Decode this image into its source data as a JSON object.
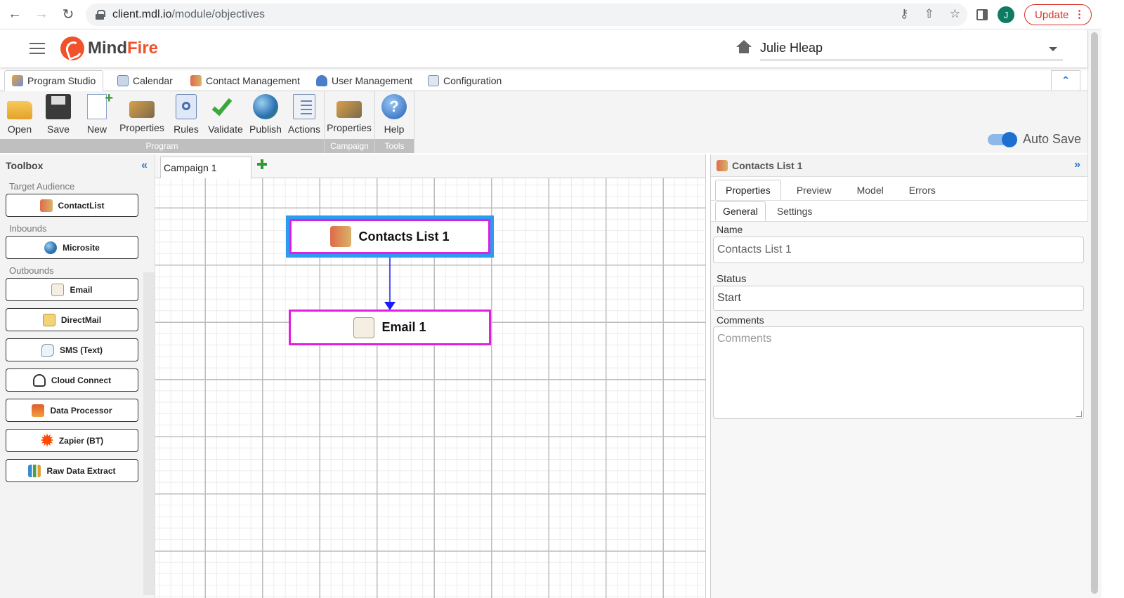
{
  "browser": {
    "url_host": "client.mdl.io",
    "url_path": "/module/objectives",
    "avatar_letter": "J",
    "update_label": "Update",
    "icons": [
      "back-icon",
      "forward-icon",
      "reload-icon",
      "lock-icon",
      "key-icon",
      "share-icon",
      "star-icon",
      "side-panel-icon",
      "more-icon"
    ]
  },
  "app": {
    "logo_mind": "Mind",
    "logo_fire": "Fire",
    "user_name": "Julie Hleap",
    "brand_color": "#f0522b"
  },
  "main_tabs": [
    {
      "label": "Program Studio",
      "icon": "program-studio-icon"
    },
    {
      "label": "Calendar",
      "icon": "calendar-icon"
    },
    {
      "label": "Contact Management",
      "icon": "contacts-icon"
    },
    {
      "label": "User Management",
      "icon": "user-icon"
    },
    {
      "label": "Configuration",
      "icon": "configuration-icon"
    }
  ],
  "ribbon": {
    "program": [
      "Open",
      "Save",
      "New",
      "Properties",
      "Rules",
      "Validate",
      "Publish",
      "Actions"
    ],
    "campaign": [
      "Properties"
    ],
    "tools": [
      "Help"
    ],
    "group_program": "Program",
    "group_campaign": "Campaign",
    "group_tools": "Tools",
    "autosave_label": "Auto Save",
    "autosave_on": true
  },
  "toolbox": {
    "title": "Toolbox",
    "sections": [
      {
        "label": "Target Audience",
        "items": [
          "ContactList"
        ]
      },
      {
        "label": "Inbounds",
        "items": [
          "Microsite"
        ]
      },
      {
        "label": "Outbounds",
        "items": [
          "Email",
          "DirectMail",
          "SMS (Text)",
          "Cloud Connect",
          "Data Processor",
          "Zapier (BT)",
          "Raw Data Extract"
        ]
      }
    ]
  },
  "canvas": {
    "tab_label": "Campaign 1",
    "nodes": [
      {
        "label": "Contacts List 1",
        "selected": true
      },
      {
        "label": "Email 1",
        "selected": false
      }
    ],
    "connector_color": "#1a1aff",
    "node_border_color": "#e020e0",
    "selection_color": "#2b9cf0"
  },
  "properties": {
    "title": "Contacts List 1",
    "tabs": [
      "Properties",
      "Preview",
      "Model",
      "Errors"
    ],
    "subtabs": [
      "General",
      "Settings"
    ],
    "name_label": "Name",
    "name_value": "Contacts List 1",
    "status_label": "Status",
    "status_value": "Start",
    "comments_label": "Comments",
    "comments_placeholder": "Comments"
  }
}
